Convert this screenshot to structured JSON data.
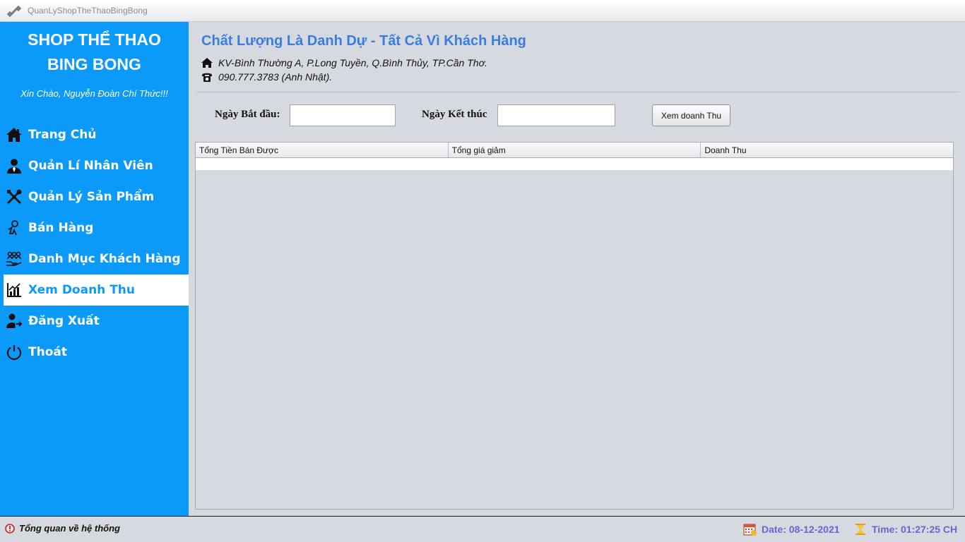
{
  "window": {
    "title": "QuanLyShopTheThaoBingBong",
    "app_icon": "dumbbell-icon"
  },
  "sidebar": {
    "brand_line1": "SHOP THỂ THAO",
    "brand_line2": "BING BONG",
    "greeting": "Xin Chào, Nguyễn Đoàn Chí Thức!!!",
    "items": [
      {
        "label": "Trang Chủ",
        "icon": "home-icon"
      },
      {
        "label": "Quản Lí Nhân Viên",
        "icon": "user-tie-icon"
      },
      {
        "label": "Quản Lý Sản Phẩm",
        "icon": "tools-icon"
      },
      {
        "label": "Bán Hàng",
        "icon": "sell-icon"
      },
      {
        "label": "Danh Mục Khách Hàng",
        "icon": "customers-hand-icon"
      },
      {
        "label": "Xem Doanh Thu",
        "icon": "revenue-chart-icon",
        "active": true
      },
      {
        "label": "Đăng Xuất",
        "icon": "logout-user-icon"
      },
      {
        "label": "Thoát",
        "icon": "power-icon"
      }
    ],
    "colors": {
      "background": "#0b9af9",
      "active_bg": "#ffffff",
      "active_text": "#0b9af9"
    }
  },
  "main": {
    "slogan": "Chất Lượng Là Danh Dự - Tất Cả Vì Khách Hàng",
    "address": "KV-Bình Thường A, P.Long Tuyền, Q.Bình Thủy, TP.Cần Thơ.",
    "phone": "090.777.3783 (Anh Nhật).",
    "filter": {
      "start_label": "Ngày Bắt đầu:",
      "start_value": "",
      "end_label": "Ngày Kết thúc",
      "end_value": "",
      "button_label": "Xem doanh Thu"
    },
    "table": {
      "columns": [
        "Tổng Tiền Bán Được",
        "Tổng giá giảm",
        "Doanh Thu"
      ],
      "rows": []
    }
  },
  "status": {
    "overview": "Tổng quan về hệ thống",
    "date": "Date: 08-12-2021",
    "time": "Time: 01:27:25 CH"
  }
}
